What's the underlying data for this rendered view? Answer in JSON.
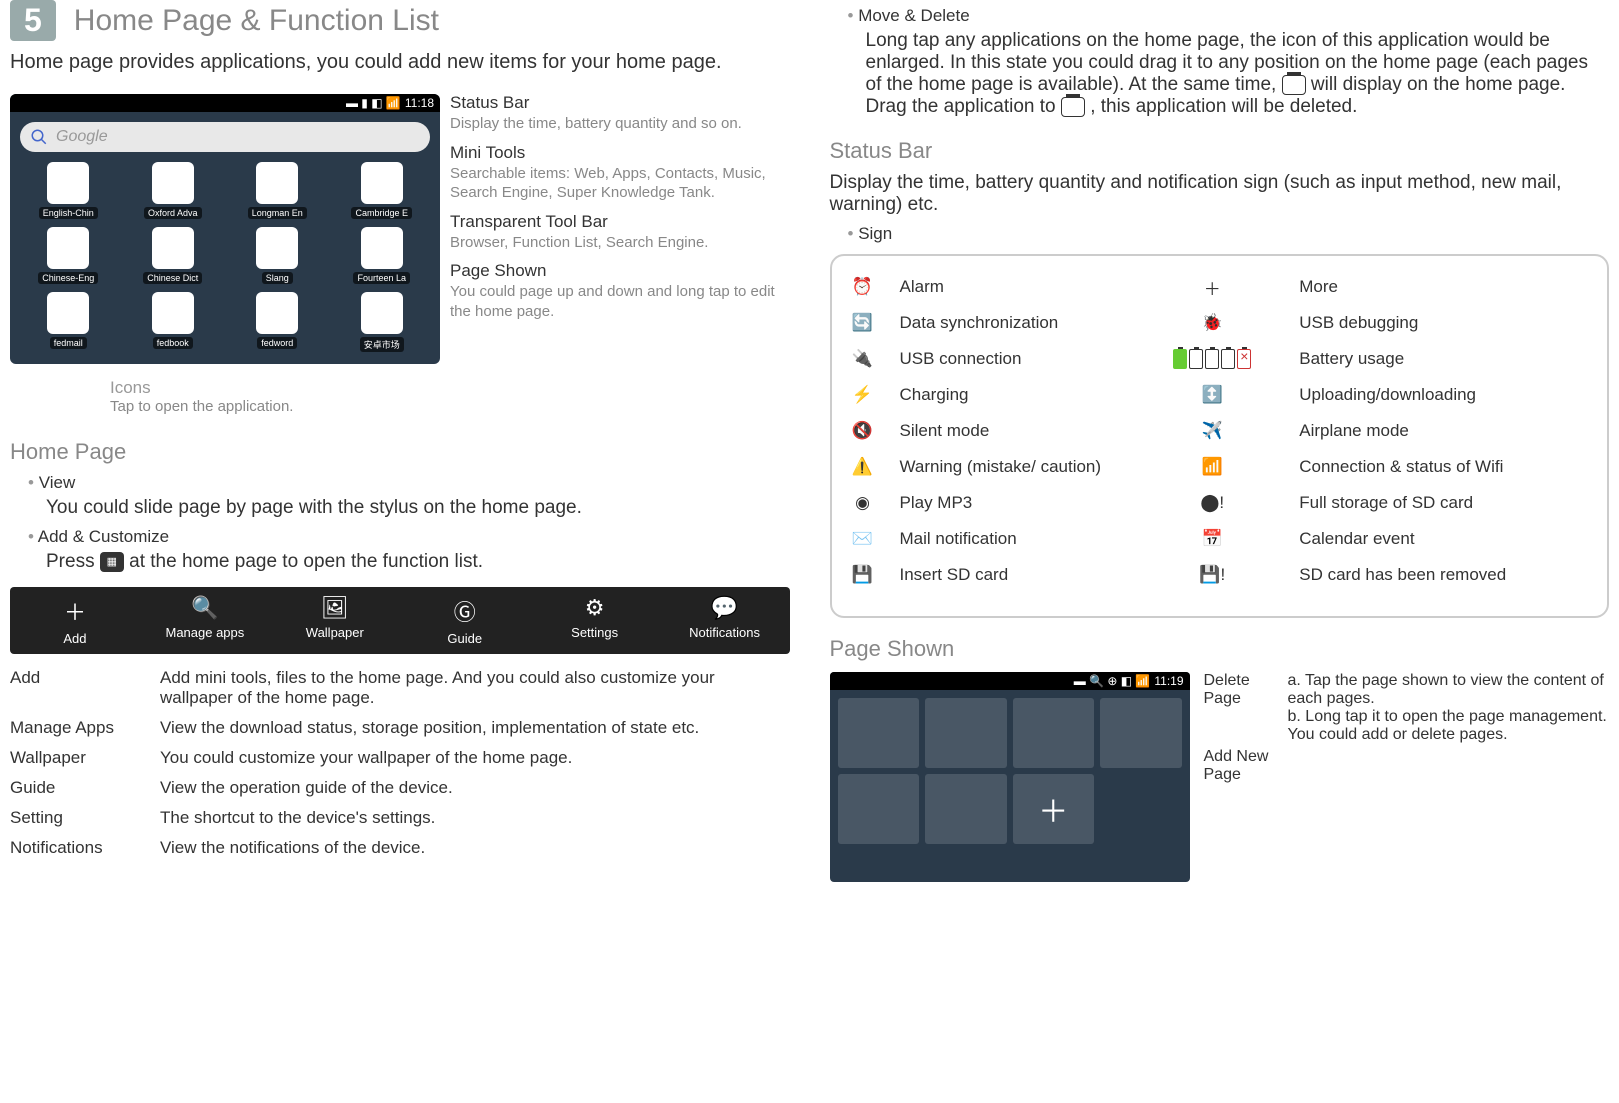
{
  "header": {
    "num": "5",
    "title": "Home Page & Function List"
  },
  "intro": "Home page provides applications, you could add new items for your home page.",
  "callouts": {
    "statusBar": {
      "t": "Status Bar",
      "b": "Display the time, battery quantity and so on."
    },
    "miniTools": {
      "t": "Mini Tools",
      "b": "Searchable items: Web, Apps, Contacts, Music, Search Engine, Super Knowledge Tank."
    },
    "toolBar": {
      "t": "Transparent Tool Bar",
      "b": "Browser, Function List, Search Engine."
    },
    "pageShown": {
      "t": "Page Shown",
      "b": "You could page up and down and long tap to edit the home page."
    },
    "icons": {
      "t": "Icons",
      "b": "Tap to open the application."
    }
  },
  "shot1": {
    "time": "11:18",
    "search": "Google",
    "apps": [
      "English-Chin",
      "Oxford Adva",
      "Longman En",
      "Cambridge E",
      "Chinese-Eng",
      "Chinese Dict",
      "Slang",
      "Fourteen La",
      "fedmail",
      "fedbook",
      "fedword",
      "安卓市场"
    ]
  },
  "homePage": {
    "h": "Home Page",
    "view": {
      "t": "View",
      "b": "You could slide page by page with the stylus on the home page."
    },
    "add": {
      "t": "Add & Customize",
      "b1": "Press",
      "b2": "at the home page to open the function list."
    }
  },
  "funcBar": [
    {
      "icon": "＋",
      "label": "Add"
    },
    {
      "icon": "🔍",
      "label": "Manage apps"
    },
    {
      "icon": "🖼",
      "label": "Wallpaper"
    },
    {
      "icon": "Ⓖ",
      "label": "Guide"
    },
    {
      "icon": "⚙",
      "label": "Settings"
    },
    {
      "icon": "💬",
      "label": "Notifications"
    }
  ],
  "funcTable": [
    {
      "k": "Add",
      "v": "Add mini tools, files to the home page. And  you could also customize your wallpaper of the home page."
    },
    {
      "k": "Manage Apps",
      "v": "View the download status, storage position, implementation of state etc."
    },
    {
      "k": "Wallpaper",
      "v": "You could customize your wallpaper of the home page."
    },
    {
      "k": "Guide",
      "v": "View the operation guide of the device."
    },
    {
      "k": "Setting",
      "v": "The shortcut to the device's settings."
    },
    {
      "k": "Notifications",
      "v": "View the notifications of the device."
    }
  ],
  "moveDelete": {
    "t": "Move & Delete",
    "p1": "Long tap any applications on the home page, the icon of this application would be enlarged. In this state you could drag it to any position on the home page (each pages of the home page is available). At the same time,",
    "p2": "will display on the home page. Drag the application to",
    "p3": ", this application will be deleted."
  },
  "statusSection": {
    "h": "Status Bar",
    "b": "Display the time, battery quantity and notification sign (such as input method, new mail, warning) etc.",
    "sign": "Sign"
  },
  "statusRows": [
    {
      "l": "Alarm",
      "r": "More"
    },
    {
      "l": "Data synchronization",
      "r": "USB debugging"
    },
    {
      "l": "USB connection",
      "r": "Battery usage"
    },
    {
      "l": "Charging",
      "r": "Uploading/downloading"
    },
    {
      "l": "Silent mode",
      "r": "Airplane mode"
    },
    {
      "l": "Warning (mistake/ caution)",
      "r": "Connection & status of Wifi"
    },
    {
      "l": "Play MP3",
      "r": "Full storage of SD card"
    },
    {
      "l": "Mail notification",
      "r": "Calendar event"
    },
    {
      "l": "Insert SD card",
      "r": "SD card has been removed"
    }
  ],
  "pageShown2": {
    "h": "Page Shown",
    "time": "11:19",
    "delete": "Delete Page",
    "addNew": "Add New Page",
    "notes": "a. Tap the page shown to view the content of each pages.\nb. Long tap it to open the page management. You could add or delete pages."
  }
}
